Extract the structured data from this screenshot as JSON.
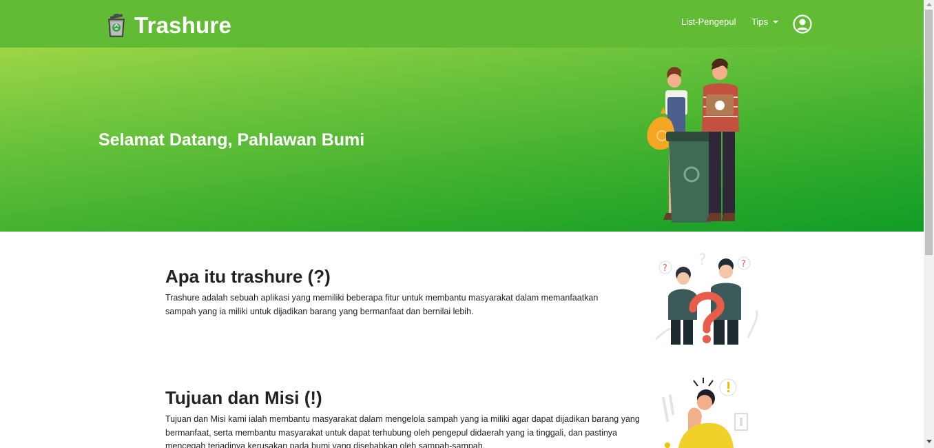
{
  "navbar": {
    "brand": "Trashure",
    "logo_icon": "recycle-bin-icon",
    "links": [
      {
        "label": "List-Pengepul"
      },
      {
        "label": "Tips"
      }
    ],
    "profile_icon": "user-circle-icon",
    "color": "#62bb35"
  },
  "hero": {
    "title": "Selamat Datang, Pahlawan Bumi",
    "illustration": "people-recycling-illustration",
    "gradient": [
      "#9dd646",
      "#0f9d26"
    ]
  },
  "sections": [
    {
      "title": "Apa itu trashure (?)",
      "text": "Trashure adalah sebuah aplikasi yang memiliki beberapa fitur untuk membantu masyarakat dalam memanfaatkan sampah yang ia miliki untuk dijadikan barang yang bermanfaat dan bernilai lebih.",
      "illustration": "questioning-people-illustration"
    },
    {
      "title": "Tujuan dan Misi (!)",
      "text": "Tujuan dan Misi kami ialah membantu masyarakat dalam mengelola sampah yang ia miliki agar dapat dijadikan barang yang bermanfaat, serta membantu masyarakat untuk dapat terhubung oleh pengepul didaerah yang ia tinggali, dan pastinya mencegah terjadinya kerusakan pada bumi yang disebabkan oleh sampah-sampah.",
      "illustration": "thinking-person-illustration"
    }
  ]
}
